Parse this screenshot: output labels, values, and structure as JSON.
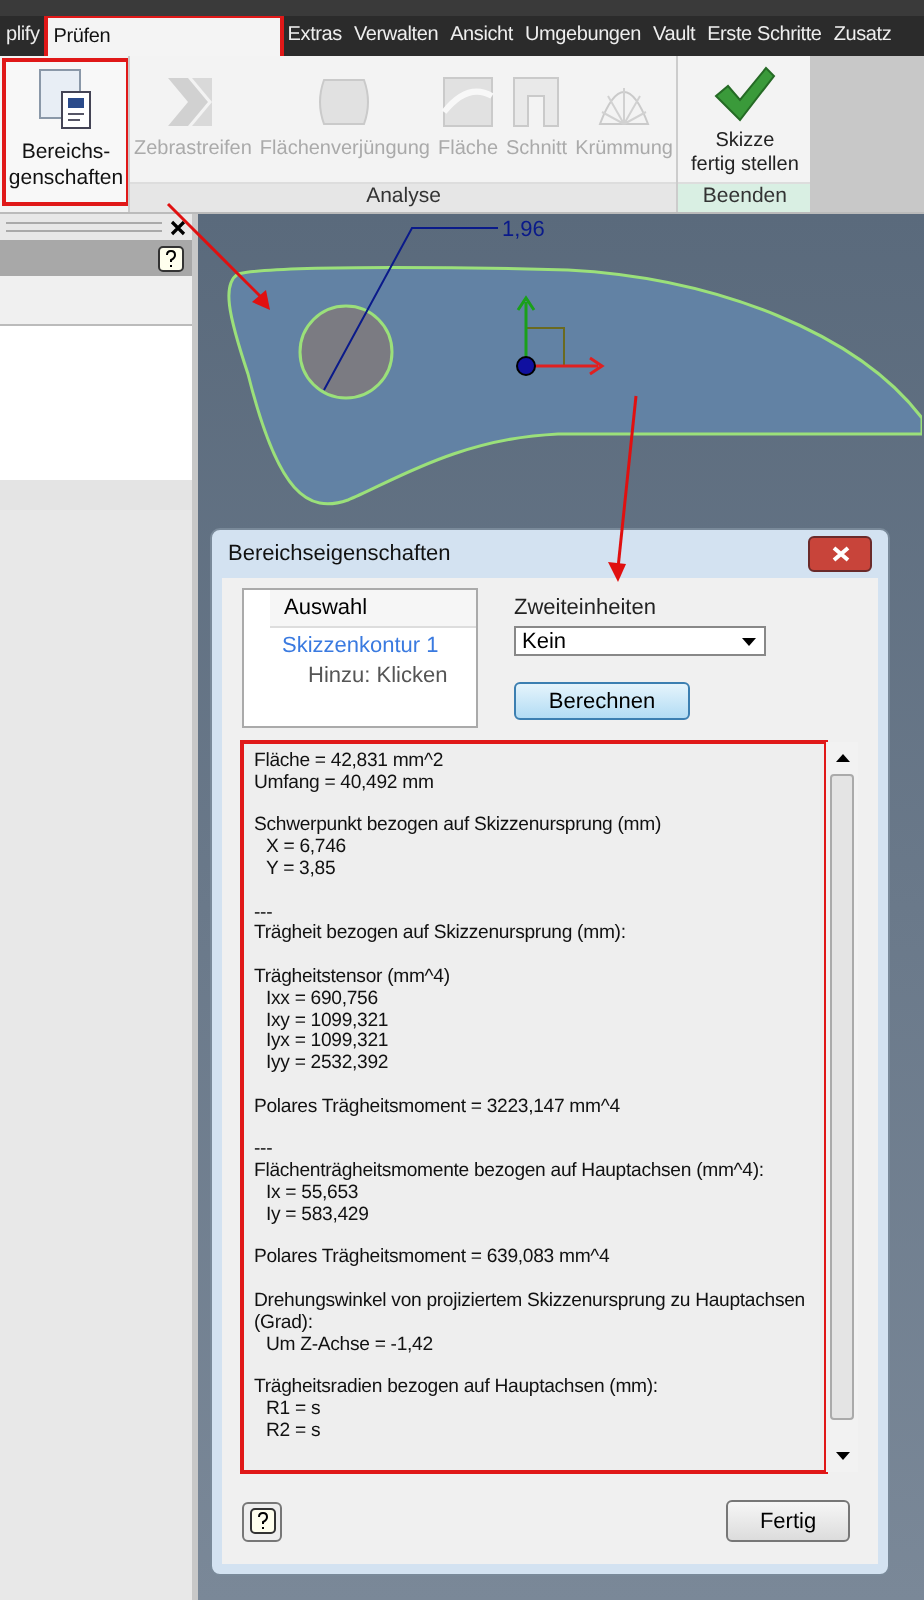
{
  "menu": [
    {
      "label": "plify",
      "selected": false,
      "annotated": false
    },
    {
      "label": "Prüfen",
      "selected": true,
      "annotated": true
    },
    {
      "label": "Extras",
      "selected": false,
      "annotated": false
    },
    {
      "label": "Verwalten",
      "selected": false,
      "annotated": false
    },
    {
      "label": "Ansicht",
      "selected": false,
      "annotated": false
    },
    {
      "label": "Umgebungen",
      "selected": false,
      "annotated": false
    },
    {
      "label": "Vault",
      "selected": false,
      "annotated": false
    },
    {
      "label": "Erste Schritte",
      "selected": false,
      "annotated": false
    },
    {
      "label": "Zusatz",
      "selected": false,
      "annotated": false
    }
  ],
  "ribbon": {
    "main_tool": {
      "label_lines": [
        "Bereichs-",
        "genschaften"
      ],
      "annotated": true
    },
    "analysis_tools": [
      {
        "label": "Zebrastreifen",
        "kind": "zebra",
        "disabled": true
      },
      {
        "label": "Flächenverjüngung",
        "kind": "draft",
        "disabled": true
      },
      {
        "label": "Fläche",
        "kind": "surface",
        "disabled": true
      },
      {
        "label": "Schnitt",
        "kind": "section",
        "disabled": true
      },
      {
        "label": "Krümmung",
        "kind": "curvature",
        "disabled": true
      }
    ],
    "analysis_panel": "Analyse",
    "finish_tool": {
      "label_lines": [
        "Skizze",
        "fertig stellen"
      ]
    },
    "finish_panel": "Beenden"
  },
  "canvas": {
    "dimension": "1,96"
  },
  "dialog": {
    "title": "Bereichseigenschaften",
    "selection_header": "Auswahl",
    "selection_items": [
      {
        "text": "Skizzenkontur 1",
        "kind": "contour"
      },
      {
        "text": "Hinzu: Klicken",
        "kind": "hint"
      }
    ],
    "secondary_units_label": "Zweiteinheiten",
    "secondary_units_value": "Kein",
    "compute_button": "Berechnen",
    "results": {
      "annotated": true,
      "sections": [
        [
          {
            "text": "Fläche = 42,831 mm^2",
            "indented": false
          },
          {
            "text": "Umfang = 40,492 mm",
            "indented": false
          }
        ],
        [
          {
            "text": "Schwerpunkt bezogen auf Skizzenursprung (mm)",
            "indented": false
          },
          {
            "text": "X = 6,746",
            "indented": true
          },
          {
            "text": "Y = 3,85",
            "indented": true
          }
        ],
        [
          {
            "text": "---",
            "indented": false
          },
          {
            "text": "Trägheit bezogen auf Skizzenursprung (mm):",
            "indented": false
          }
        ],
        [
          {
            "text": "Trägheitstensor (mm^4)",
            "indented": false
          },
          {
            "text": "Ixx = 690,756",
            "indented": true
          },
          {
            "text": "Ixy = 1099,321",
            "indented": true
          },
          {
            "text": "Iyx = 1099,321",
            "indented": true
          },
          {
            "text": "Iyy = 2532,392",
            "indented": true
          }
        ],
        [
          {
            "text": "Polares Trägheitsmoment = 3223,147 mm^4",
            "indented": false
          }
        ],
        [
          {
            "text": "---",
            "indented": false
          },
          {
            "text": "Flächenträgheitsmomente bezogen auf Hauptachsen (mm^4):",
            "indented": false
          },
          {
            "text": "Ix = 55,653",
            "indented": true
          },
          {
            "text": "Iy = 583,429",
            "indented": true
          }
        ],
        [
          {
            "text": "Polares Trägheitsmoment = 639,083 mm^4",
            "indented": false
          }
        ],
        [
          {
            "text": "Drehungswinkel von projiziertem Skizzenursprung zu Hauptachsen (Grad):",
            "indented": false
          },
          {
            "text": "Um Z-Achse = -1,42",
            "indented": true
          }
        ],
        [
          {
            "text": "Trägheitsradien bezogen auf Hauptachsen (mm):",
            "indented": false
          },
          {
            "text": "R1 = s",
            "indented": true
          },
          {
            "text": "R2 = s",
            "indented": true
          }
        ]
      ]
    },
    "finish_button": "Fertig"
  }
}
